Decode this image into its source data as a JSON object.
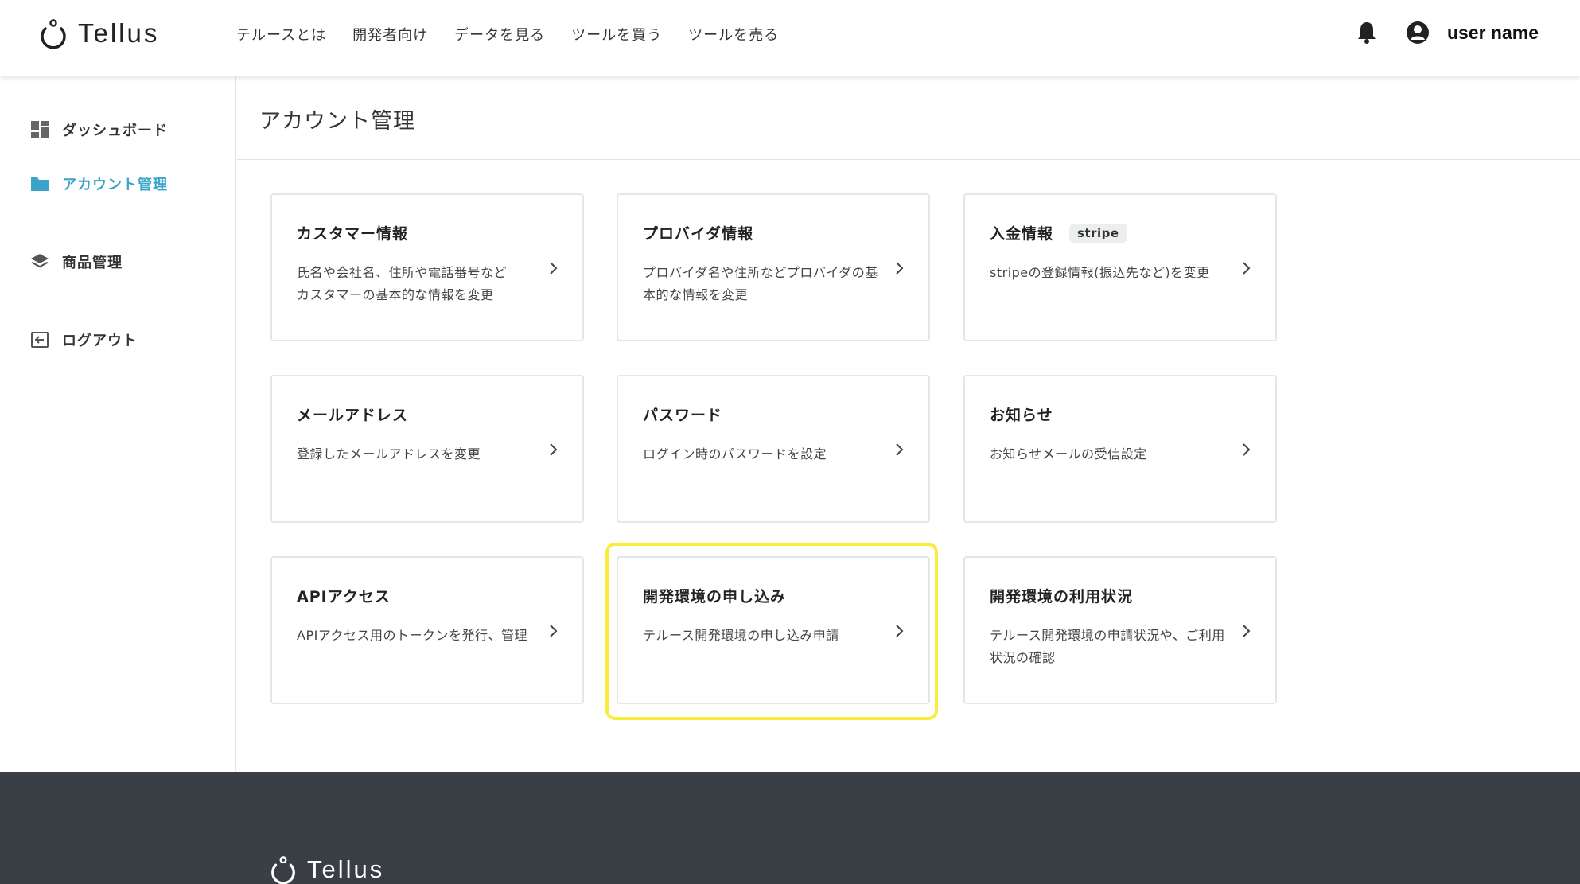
{
  "header": {
    "logo_text": "Tellus",
    "nav": [
      "テルースとは",
      "開発者向け",
      "データを見る",
      "ツールを買う",
      "ツールを売る"
    ],
    "user_name": "user name"
  },
  "sidebar": {
    "items": [
      {
        "label": "ダッシュボード",
        "icon": "dashboard-icon"
      },
      {
        "label": "アカウント管理",
        "icon": "folder-icon",
        "active": true
      },
      {
        "label": "商品管理",
        "icon": "layers-icon"
      },
      {
        "label": "ログアウト",
        "icon": "logout-icon"
      }
    ]
  },
  "main": {
    "title": "アカウント管理",
    "cards": [
      {
        "title": "カスタマー情報",
        "desc": "氏名や会社名、住所や電話番号など\nカスタマーの基本的な情報を変更"
      },
      {
        "title": "プロバイダ情報",
        "desc": "プロバイダ名や住所などプロバイダの基本的な情報を変更"
      },
      {
        "title": "入金情報",
        "badge": "stripe",
        "desc": "stripeの登録情報(振込先など)を変更"
      },
      {
        "title": "メールアドレス",
        "desc": "登録したメールアドレスを変更"
      },
      {
        "title": "パスワード",
        "desc": "ログイン時のパスワードを設定"
      },
      {
        "title": "お知らせ",
        "desc": "お知らせメールの受信設定"
      },
      {
        "title": "APIアクセス",
        "desc": "APIアクセス用のトークンを発行、管理"
      },
      {
        "title": "開発環境の申し込み",
        "desc": "テルース開発環境の申し込み申請",
        "highlighted": true
      },
      {
        "title": "開発環境の利用状況",
        "desc": "テルース開発環境の申請状況や、ご利用状況の確認"
      }
    ]
  },
  "footer": {
    "logo_text": "Tellus"
  },
  "colors": {
    "accent": "#3aa3c7",
    "highlight": "#f8ee3a",
    "footer_bg": "#3a3f45"
  }
}
